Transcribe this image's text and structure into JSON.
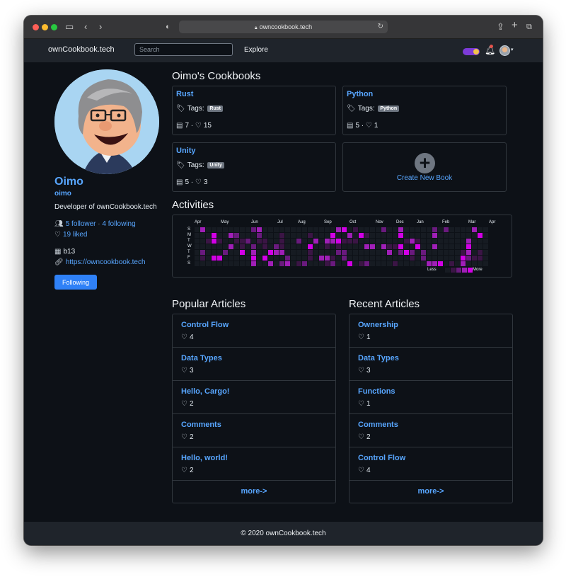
{
  "browser": {
    "url": "owncookbook.tech"
  },
  "navbar": {
    "brand": "ownCookbook.tech",
    "search_placeholder": "Search",
    "explore": "Explore"
  },
  "profile": {
    "name": "Oimo",
    "login": "oimo",
    "bio": "Developer of ownCookbook.tech",
    "followers": "5 follower",
    "following": "4 following",
    "liked": "19 liked",
    "organization": "b13",
    "website": "https://owncookbook.tech",
    "follow_button": "Following"
  },
  "cookbooks": {
    "title": "Oimo's Cookbooks",
    "tags_label": "Tags:",
    "items": [
      {
        "name": "Rust",
        "tag": "Rust",
        "articles": "7",
        "likes": "15"
      },
      {
        "name": "Python",
        "tag": "Python",
        "articles": "5",
        "likes": "1"
      },
      {
        "name": "Unity",
        "tag": "Unity",
        "articles": "5",
        "likes": "3"
      }
    ],
    "create_label": "Create New Book"
  },
  "activities": {
    "title": "Activities",
    "months": [
      "Apr",
      "May",
      "Jun",
      "Jul",
      "Aug",
      "Sep",
      "Oct",
      "Nov",
      "Dec",
      "Jan",
      "Feb",
      "Mar",
      "Apr"
    ],
    "days": [
      "S",
      "M",
      "T",
      "W",
      "T",
      "F",
      "S"
    ],
    "legend_less": "Less",
    "legend_more": "More",
    "colors": [
      "#161b22",
      "#3b1545",
      "#6a1a7e",
      "#a01fb7",
      "#d200e6"
    ]
  },
  "popular_articles": {
    "title": "Popular Articles",
    "items": [
      {
        "title": "Control Flow",
        "likes": "4"
      },
      {
        "title": "Data Types",
        "likes": "3"
      },
      {
        "title": "Hello, Cargo!",
        "likes": "2"
      },
      {
        "title": "Comments",
        "likes": "2"
      },
      {
        "title": "Hello, world!",
        "likes": "2"
      }
    ],
    "more": "more->"
  },
  "recent_articles": {
    "title": "Recent Articles",
    "items": [
      {
        "title": "Ownership",
        "likes": "1"
      },
      {
        "title": "Data Types",
        "likes": "3"
      },
      {
        "title": "Functions",
        "likes": "1"
      },
      {
        "title": "Comments",
        "likes": "2"
      },
      {
        "title": "Control Flow",
        "likes": "4"
      }
    ],
    "more": "more->"
  },
  "footer": {
    "text": "© 2020 ownCookbook.tech"
  }
}
